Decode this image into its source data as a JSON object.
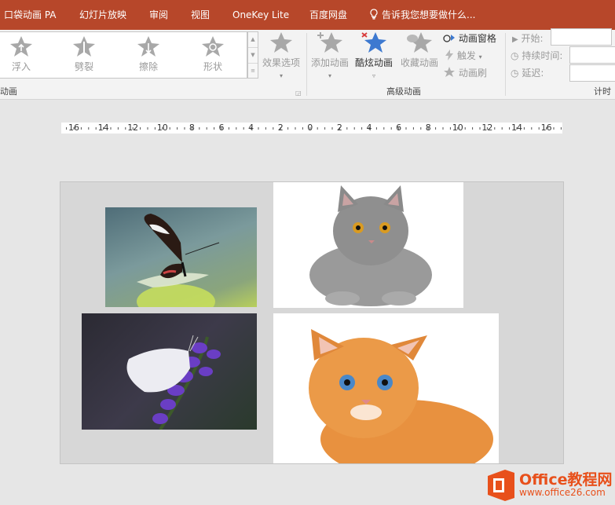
{
  "tabs": [
    "口袋动画 PA",
    "幻灯片放映",
    "审阅",
    "视图",
    "OneKey Lite",
    "百度网盘"
  ],
  "tell_me": "告诉我您想要做什么...",
  "gallery": [
    "浮入",
    "劈裂",
    "擦除",
    "形状"
  ],
  "effect_options": "效果选项",
  "group_animation": "动画",
  "add_animation": "添加动画",
  "cool_animation": "酷炫动画",
  "collect_animation": "收藏动画",
  "animation_pane": "动画窗格",
  "trigger": "触发",
  "anim_painter": "动画刷",
  "group_advanced": "高级动画",
  "start_label": "开始:",
  "duration_label": "持续时间:",
  "delay_label": "延迟:",
  "group_timing": "计时",
  "ruler": [
    "16",
    "14",
    "12",
    "10",
    "8",
    "6",
    "4",
    "2",
    "0",
    "2",
    "4",
    "6",
    "8",
    "10",
    "12",
    "14",
    "16"
  ],
  "watermark": {
    "brand": "Office教程网",
    "url": "www.office26.com",
    "color": "#e8501b"
  },
  "colors": {
    "tabbar": "#b7472a",
    "star_active": "#3d79d0"
  }
}
